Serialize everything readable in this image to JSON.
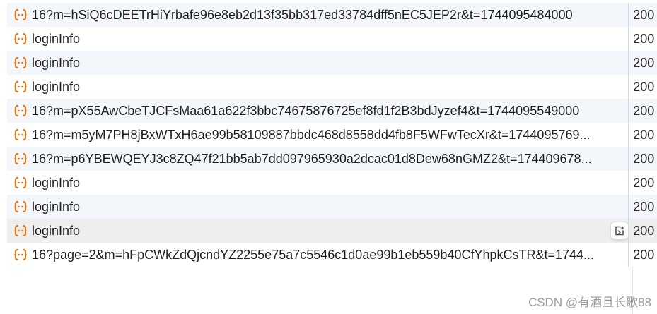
{
  "network": {
    "rows": [
      {
        "name": "16?m=hSiQ6cDEETrHiYrbafe96e8eb2d13f35bb317ed33784dff5nEC5JEP2r&t=1744095484000",
        "status": "200",
        "style": "alt"
      },
      {
        "name": "loginInfo",
        "status": "200",
        "style": ""
      },
      {
        "name": "loginInfo",
        "status": "200",
        "style": "alt"
      },
      {
        "name": "loginInfo",
        "status": "200",
        "style": ""
      },
      {
        "name": "16?m=pX55AwCbeTJCFsMaa61a622f3bbc74675876725ef8fd1f2B3bdJyzef4&t=1744095549000",
        "status": "200",
        "style": "alt"
      },
      {
        "name": "16?m=m5yM7PH8jBxWTxH6ae99b58109887bbdc468d8558dd4fb8F5WFwTecXr&t=1744095769...",
        "status": "200",
        "style": ""
      },
      {
        "name": "16?m=p6YBEWQEYJ3c8ZQ47f21bb5ab7dd097965930a2dcac01d8Dew68nGMZ2&t=174409678...",
        "status": "200",
        "style": "alt"
      },
      {
        "name": "loginInfo",
        "status": "200",
        "style": ""
      },
      {
        "name": "loginInfo",
        "status": "200",
        "style": "alt"
      },
      {
        "name": "loginInfo",
        "status": "200",
        "style": "hover"
      },
      {
        "name": "16?page=2&m=hFpCWkZdQjcndYZ2255e75a7c5546c1d0ae99b1eb559b40CfYhpkCsTR&t=1744...",
        "status": "200",
        "style": ""
      }
    ],
    "icon": "fetch-xhr-icon",
    "accent_color": "#e8710a"
  },
  "watermark": "CSDN @有酒且长歌88"
}
